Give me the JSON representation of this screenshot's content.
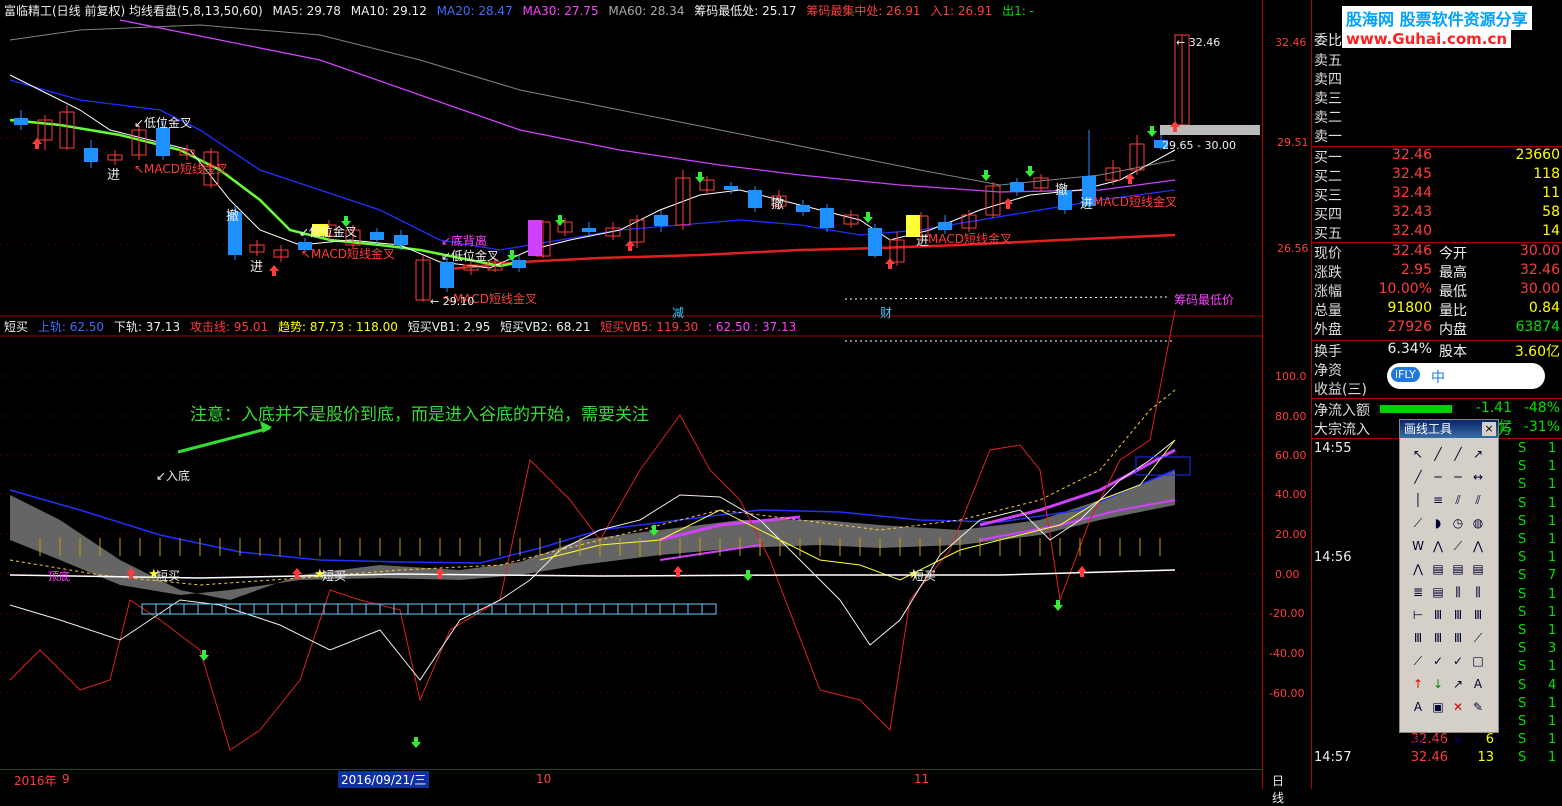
{
  "header": {
    "title": "富临精工(日线 前复权) 均线看盘(5,8,13,50,60)",
    "ma5": "MA5: 29.78",
    "ma10": "MA10: 29.12",
    "ma20": "MA20: 28.47",
    "ma30": "MA30: 27.75",
    "ma60": "MA60: 28.34",
    "chip_low": "筹码最低处: 25.17",
    "chip_mid": "筹码最集中处: 26.91",
    "entry": "入1: 26.91",
    "exit": "出1: -"
  },
  "sub_header": {
    "name": "短买",
    "upper": "上轨: 62.50",
    "lower": "下轨: 37.13",
    "attack": "攻击线: 95.01",
    "trend": "趋势: 87.73 : 118.00",
    "vb1": "短买VB1: 2.95",
    "vb2": "短买VB2: 68.21",
    "vb5": "短买VB5: 119.30",
    "extra": ": 62.50 : 37.13"
  },
  "price_axis": [
    "32.46",
    "29.51",
    "26.56"
  ],
  "indicator_axis": [
    "100.0",
    "80.00",
    "60.00",
    "40.00",
    "20.00",
    "0.00",
    "-20.00",
    "-40.00",
    "-60.00"
  ],
  "annotations": {
    "note": "注意：入底并不是股价到底，而是进入谷底的开始，需要关注",
    "into_bottom": "↙入底",
    "low_gold_1": "↙低位金叉",
    "macd_gold_1": "↖MACD短线金叉",
    "enter": "进",
    "cancel": "撤",
    "low_gold_2": "↙低位金叉",
    "macd_gold_2": "↖MACD短线金叉",
    "bottom_div": "↙底背离",
    "low_gold_3": "↙低位金叉",
    "macd_gold_3": "↖MACD短线金叉",
    "low_price": "← 29.10",
    "macd_gold_4": "MACD短线金叉",
    "macd_gold_5": "MACD短线金叉",
    "high_price": "← 32.46",
    "range_label": "29.65 - 30.00",
    "chip_low_label": "筹码最低价",
    "reduce": "减",
    "finance": "财",
    "short_buy": "短买",
    "short_buy_2": "短买",
    "short_buy_3": "短买",
    "dingdi": "顶底"
  },
  "bottom_bar": {
    "year": "2016年",
    "m9": "9",
    "date": "2016/09/21/三",
    "m10": "10",
    "m11": "11",
    "period": "日线"
  },
  "right_panel": {
    "logo": "股海网 股票软件资源分享",
    "url": "www.Guhai.com.cn",
    "weibi": "委比",
    "sells": [
      "卖五",
      "卖四",
      "卖三",
      "卖二",
      "卖一"
    ],
    "buys": [
      {
        "label": "买一",
        "price": "32.46",
        "vol": "23660"
      },
      {
        "label": "买二",
        "price": "32.45",
        "vol": "118"
      },
      {
        "label": "买三",
        "price": "32.44",
        "vol": "11"
      },
      {
        "label": "买四",
        "price": "32.43",
        "vol": "58"
      },
      {
        "label": "买五",
        "price": "32.40",
        "vol": "14"
      }
    ],
    "quote": [
      {
        "l1": "现价",
        "v1": "32.46",
        "l2": "今开",
        "v2": "30.00"
      },
      {
        "l1": "涨跌",
        "v1": "2.95",
        "l2": "最高",
        "v2": "32.46"
      },
      {
        "l1": "涨幅",
        "v1": "10.00%",
        "l2": "最低",
        "v2": "30.00"
      },
      {
        "l1": "总量",
        "v1": "91800",
        "l2": "量比",
        "v2": "0.84"
      },
      {
        "l1": "外盘",
        "v1": "27926",
        "l2": "内盘",
        "v2": "63874"
      }
    ],
    "turnover_label": "换手",
    "turnover": "6.34%",
    "equity_label": "股本",
    "equity": "3.60亿",
    "netasset_label": "净资",
    "earnings_label": "收益(三)",
    "netflow_label": "净流入额",
    "netflow": "-1.41亿",
    "netflow_pct": "-48%",
    "bigflow_label": "大宗流入",
    "bigflow": "万",
    "bigflow_pct": "-31%",
    "ime": [
      "iFLY",
      "中"
    ],
    "trades": [
      {
        "time": "14:55",
        "price": "",
        "vol": "",
        "side": "S",
        "n": "1"
      },
      {
        "time": "",
        "price": "",
        "vol": "",
        "side": "S",
        "n": "1"
      },
      {
        "time": "",
        "price": "",
        "vol": "",
        "side": "S",
        "n": "1"
      },
      {
        "time": "",
        "price": "",
        "vol": "",
        "side": "S",
        "n": "1"
      },
      {
        "time": "",
        "price": "",
        "vol": "",
        "side": "S",
        "n": "1"
      },
      {
        "time": "",
        "price": "",
        "vol": "",
        "side": "S",
        "n": "1"
      },
      {
        "time": "14:56",
        "price": "",
        "vol": "",
        "side": "S",
        "n": "1"
      },
      {
        "time": "",
        "price": "",
        "vol": "",
        "side": "S",
        "n": "7"
      },
      {
        "time": "",
        "price": "",
        "vol": "",
        "side": "S",
        "n": "1"
      },
      {
        "time": "",
        "price": "",
        "vol": "",
        "side": "S",
        "n": "1"
      },
      {
        "time": "",
        "price": "",
        "vol": "",
        "side": "S",
        "n": "1"
      },
      {
        "time": "",
        "price": "",
        "vol": "",
        "side": "S",
        "n": "3"
      },
      {
        "time": "",
        "price": "",
        "vol": "",
        "side": "S",
        "n": "1"
      },
      {
        "time": "",
        "price": "",
        "vol": "",
        "side": "S",
        "n": "4"
      },
      {
        "time": "",
        "price": "",
        "vol": "",
        "side": "S",
        "n": "1"
      },
      {
        "time": "",
        "price": "",
        "vol": "",
        "side": "S",
        "n": "1"
      },
      {
        "time": "",
        "price": "32.46",
        "vol": "6",
        "side": "S",
        "n": "1"
      },
      {
        "time": "14:57",
        "price": "32.46",
        "vol": "13",
        "side": "S",
        "n": "1"
      }
    ]
  },
  "toolbox": {
    "title": "画线工具",
    "close": "×"
  },
  "colors": {
    "up": "#ff3c3c",
    "down": "#1e90ff",
    "ma_white": "#ffffff",
    "ma_green": "#66ff33",
    "ma_blue": "#2030ff",
    "ma_magenta": "#d040ff",
    "ma_red": "#e02020"
  }
}
